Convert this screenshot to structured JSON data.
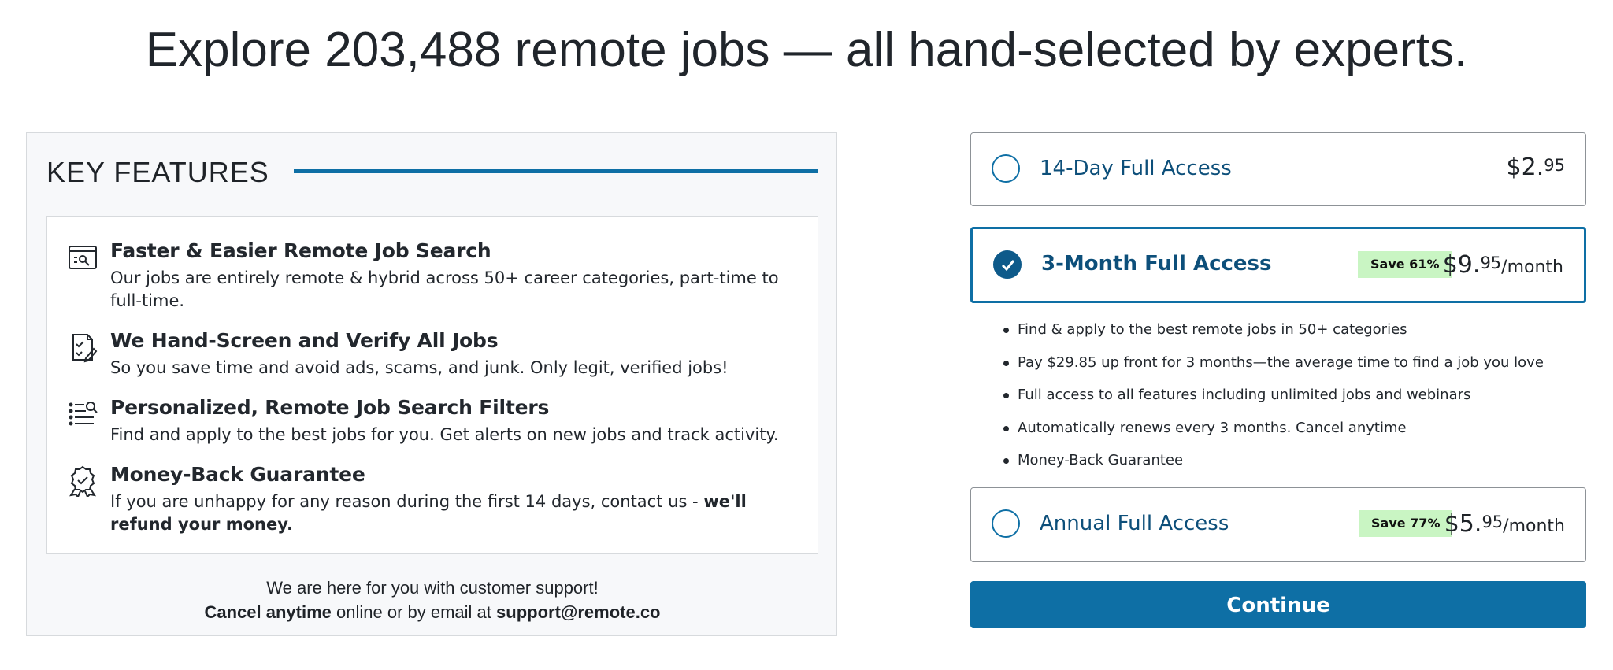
{
  "headline": "Explore 203,488 remote jobs — all hand-selected by experts.",
  "features": {
    "title": "KEY FEATURES",
    "items": [
      {
        "icon": "search-window-icon",
        "title": "Faster & Easier Remote Job Search",
        "description": "Our jobs are entirely remote & hybrid across 50+ career categories, part-time to full-time."
      },
      {
        "icon": "verified-document-icon",
        "title": "We Hand-Screen and Verify All Jobs",
        "description": "So you save time and avoid ads, scams, and junk. Only legit, verified jobs!"
      },
      {
        "icon": "filter-list-icon",
        "title": "Personalized, Remote Job Search Filters",
        "description": "Find and apply to the best jobs for you. Get alerts on new jobs and track activity."
      },
      {
        "icon": "award-ribbon-icon",
        "title": "Money-Back Guarantee",
        "description_prefix": "If you are unhappy for any reason during the first 14 days, contact us - ",
        "description_bold": "we'll refund your money."
      }
    ]
  },
  "support": {
    "line1": "We are here for you with customer support!",
    "cancel_bold": "Cancel anytime",
    "line2_middle": " online or by email at ",
    "email": "support@remote.co"
  },
  "plans": [
    {
      "name": "14-Day Full Access",
      "price_whole": "$2.",
      "price_cents": "95",
      "price_unit": "",
      "badge": "",
      "selected": false
    },
    {
      "name": "3-Month Full Access",
      "price_whole": "$9.",
      "price_cents": "95",
      "price_unit": "/month",
      "badge": "Save 61%",
      "selected": true
    },
    {
      "name": "Annual Full Access",
      "price_whole": "$5.",
      "price_cents": "95",
      "price_unit": "/month",
      "badge": "Save 77%",
      "selected": false
    }
  ],
  "benefits": [
    "Find & apply to the best remote jobs in 50+ categories",
    "Pay $29.85 up front for 3 months—the average time to find a job you love",
    "Full access to all features including unlimited jobs and webinars",
    "Automatically renews every 3 months. Cancel anytime",
    "Money-Back Guarantee"
  ],
  "continue_label": "Continue",
  "colors": {
    "accent": "#0e6fa5",
    "plan_text": "#0d4f7a",
    "badge_bg": "#c9f5c3",
    "panel_bg": "#f7f8fa"
  }
}
